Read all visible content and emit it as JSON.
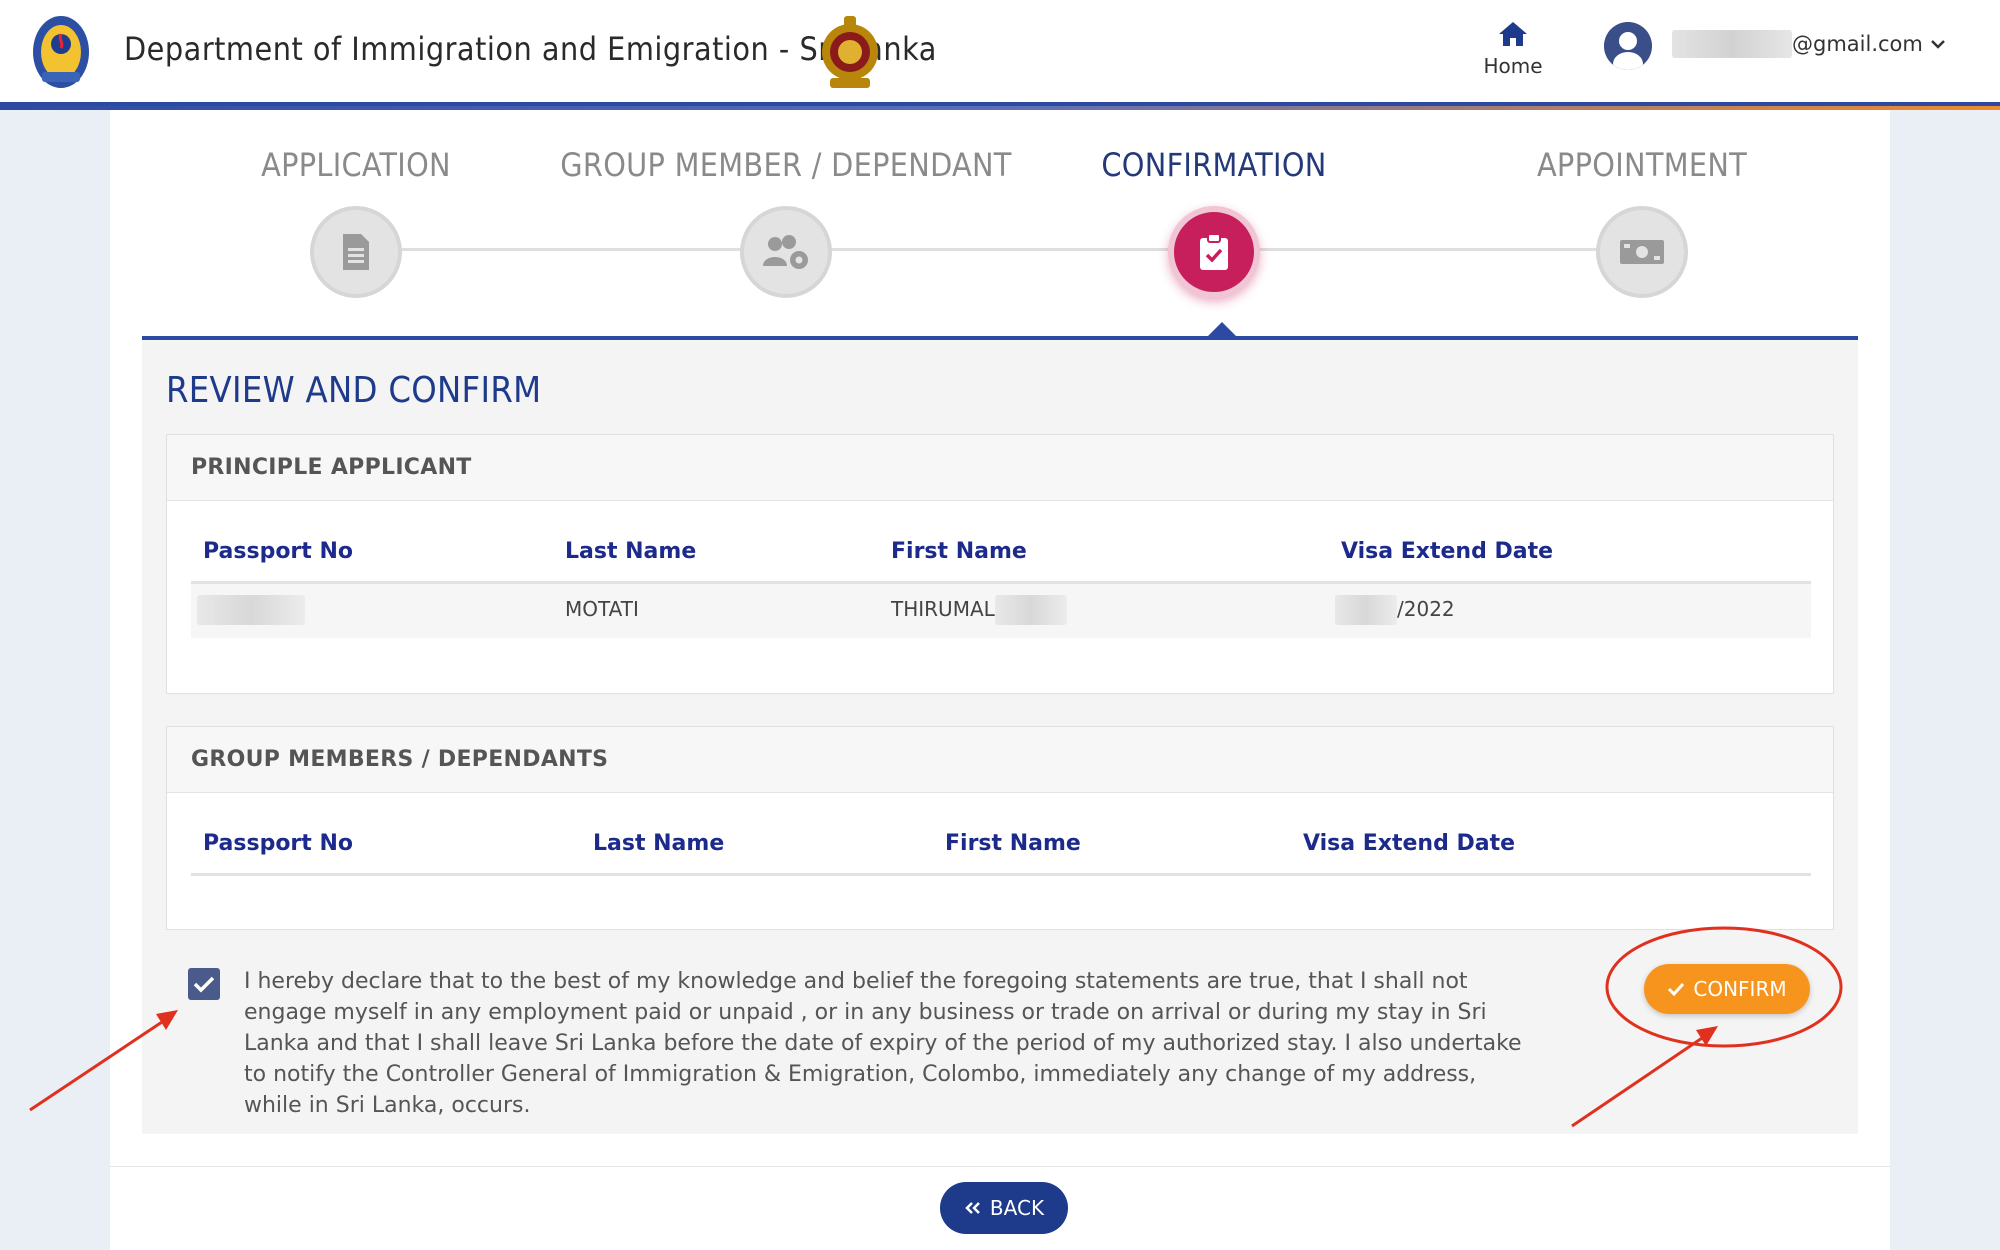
{
  "header": {
    "title": "Department of Immigration and Emigration - Sri Lanka",
    "home_label": "Home",
    "email_suffix": "@gmail.com",
    "caret": "⌄"
  },
  "steps": [
    {
      "label": "APPLICATION",
      "icon": "document-icon",
      "active": false
    },
    {
      "label": "GROUP MEMBER / DEPENDANT",
      "icon": "users-gear-icon",
      "active": false
    },
    {
      "label": "CONFIRMATION",
      "icon": "clipboard-check-icon",
      "active": true
    },
    {
      "label": "APPOINTMENT",
      "icon": "money-icon",
      "active": false
    }
  ],
  "review": {
    "title": "REVIEW AND CONFIRM",
    "principal": {
      "heading": "PRINCIPLE APPLICANT",
      "columns": [
        "Passport No",
        "Last Name",
        "First Name",
        "Visa Extend Date"
      ],
      "row": {
        "last_name": "MOTATI",
        "first_name": "THIRUMAL",
        "visa_date_suffix": "/2022"
      }
    },
    "group": {
      "heading": "GROUP MEMBERS / DEPENDANTS",
      "columns": [
        "Passport No",
        "Last Name",
        "First Name",
        "Visa Extend Date"
      ]
    }
  },
  "declaration": {
    "checked": true,
    "text": "I hereby declare that to the best of my knowledge and belief the foregoing statements are true, that I shall not engage myself in any employment paid or unpaid , or in any business or trade on arrival or during my stay in Sri Lanka and that I shall leave Sri Lanka before the date of expiry of the period of my authorized stay. I also undertake to notify the Controller General of Immigration & Emigration, Colombo, immediately any change of my address, while in Sri Lanka, occurs."
  },
  "buttons": {
    "confirm": "CONFIRM",
    "back": "BACK"
  },
  "colors": {
    "brand_blue": "#1e3a8a",
    "active_step": "#c71e5c",
    "confirm_orange": "#f7941d",
    "annotation_red": "#e0301e"
  }
}
